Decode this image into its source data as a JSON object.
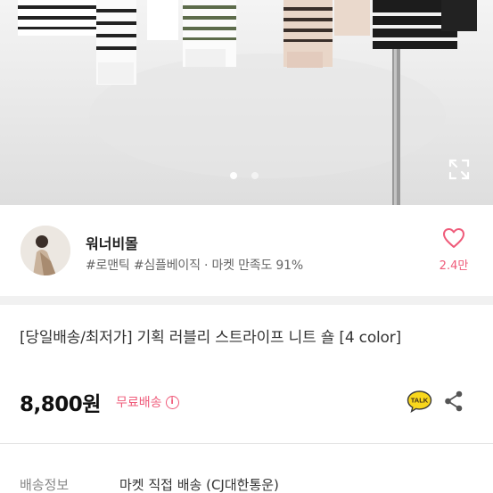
{
  "hero": {
    "icons": [
      "expand-icon"
    ],
    "slide_count": 2,
    "active_slide": 1
  },
  "shop": {
    "name": "워너비몰",
    "tags": "#로맨틱 #심플베이직 · 마켓 만족도 91%",
    "like_count": "2.4만",
    "like_icon": "heart-outline-icon",
    "accent": "#ef5b7a"
  },
  "product": {
    "title": "[당일배송/최저가] 기획 러블리 스트라이프 니트 숄 [4 color]",
    "price": "8,800원",
    "shipping_badge": "무료배송",
    "info_icon": "i",
    "talk_label": "TALK",
    "share_icon": "share-icon"
  },
  "delivery": {
    "label": "배송정보",
    "value": "마켓 직접 배송 (CJ대한통운)"
  }
}
